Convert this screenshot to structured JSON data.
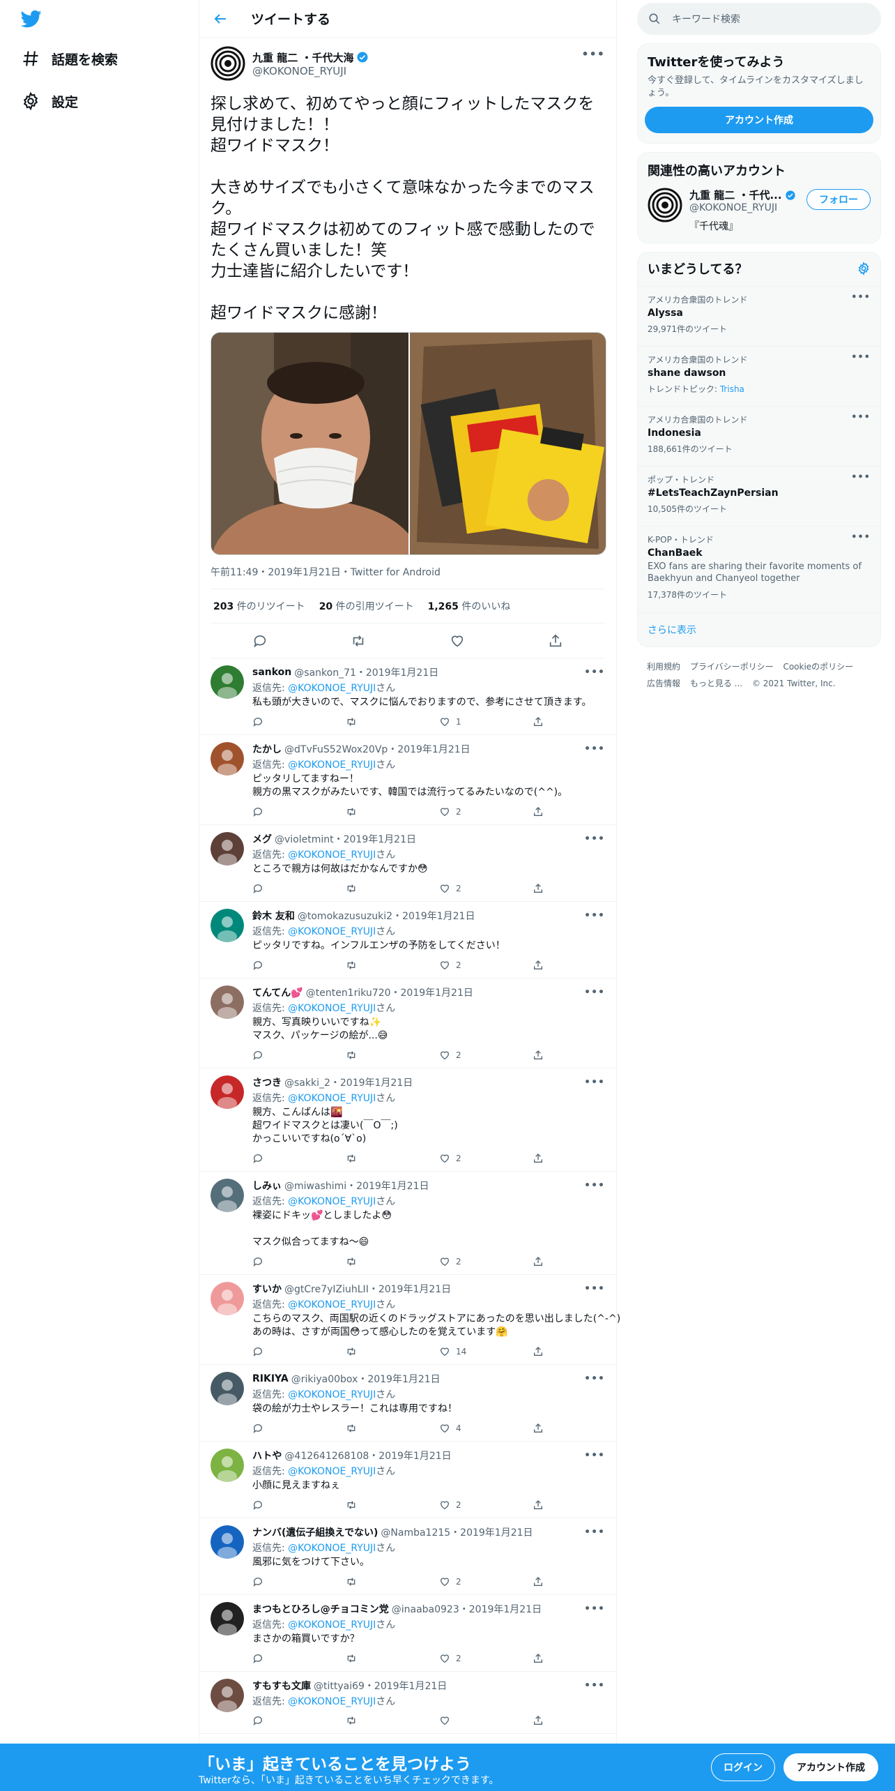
{
  "nav": {
    "logo": "twitter-logo",
    "explore": "話題を検索",
    "settings": "設定"
  },
  "header": {
    "title": "ツイートする"
  },
  "main_tweet": {
    "name": "九重 龍二 ・千代大海",
    "handle": "@KOKONOE_RYUJI",
    "text": "探し求めて、初めてやっと顔にフィットしたマスクを見付けました！！\n超ワイドマスク！\n\n大きめサイズでも小さくて意味なかった今までのマスク。\n超ワイドマスクは初めてのフィット感で感動したのでたくさん買いました！笑\n力士達皆に紹介したいです！\n\n超ワイドマスクに感謝！",
    "meta": "午前11:49・2019年1月21日・Twitter for Android",
    "retweets": "203",
    "retweets_label": "件のリツイート",
    "quotes": "20",
    "quotes_label": "件の引用ツイート",
    "likes": "1,265",
    "likes_label": "件のいいね"
  },
  "reply_prefix": "返信先: ",
  "reply_to": "@KOKONOE_RYUJI",
  "reply_suffix": "さん",
  "replies": [
    {
      "name": "sankon",
      "meta": "@sankon_71・2019年1月21日",
      "text": "私も頭が大きいので、マスクに悩んでおりますので、参考にさせて頂きます。",
      "likes": "1"
    },
    {
      "name": "たかし",
      "meta": "@dTvFuS52Wox20Vp・2019年1月21日",
      "text": "ピッタリしてますねー！\n親方の黒マスクがみたいです、韓国では流行ってるみたいなので(^^)。",
      "likes": "2"
    },
    {
      "name": "メグ",
      "meta": "@violetmint・2019年1月21日",
      "text": "ところで親方は何故はだかなんですか😳",
      "likes": "2"
    },
    {
      "name": "鈴木 友和",
      "meta": "@tomokazusuzuki2・2019年1月21日",
      "text": "ピッタリですね。インフルエンザの予防をしてください！",
      "likes": "2"
    },
    {
      "name": "てんてん💕",
      "meta": "@tenten1riku720・2019年1月21日",
      "text": "親方、写真映りいいですね✨\nマスク、パッケージの絵が...😅",
      "likes": "2"
    },
    {
      "name": "さつき",
      "meta": "@sakki_2・2019年1月21日",
      "text": "親方、こんばんは🌇\n超ワイドマスクとは凄い(￣O￣;)\nかっこいいですね(o´∀`o)",
      "likes": "2"
    },
    {
      "name": "しみぃ",
      "meta": "@miwashimi・2019年1月21日",
      "text": "裸姿にドキッ💕としましたよ😳\n\nマスク似合ってますね～😄",
      "likes": "2"
    },
    {
      "name": "すいか",
      "meta": "@gtCre7yIZiuhLII・2019年1月21日",
      "text": "こちらのマスク、両国駅の近くのドラッグストアにあったのを思い出しました(^-^)\nあの時は、さすが両国😳って感心したのを覚えています🤗",
      "likes": "14"
    },
    {
      "name": "RIKIYA",
      "meta": "@rikiya00box・2019年1月21日",
      "text": "袋の絵が力士やレスラー！これは専用ですね！",
      "likes": "4"
    },
    {
      "name": "ハトや",
      "meta": "@412641268108・2019年1月21日",
      "text": "小顔に見えますねぇ",
      "likes": "2"
    },
    {
      "name": "ナンバ(遺伝子組換えでない)",
      "meta": "@Namba1215・2019年1月21日",
      "text": "風邪に気をつけて下さい。",
      "likes": "2"
    },
    {
      "name": "まつもとひろし@チョコミン党",
      "meta": "@inaaba0923・2019年1月21日",
      "text": "まさかの箱買いですか？",
      "likes": "2"
    },
    {
      "name": "すもすも文庫",
      "meta": "@tittyai69・2019年1月21日",
      "text": "",
      "likes": ""
    }
  ],
  "right": {
    "search_placeholder": "キーワード検索",
    "join_title": "Twitterを使ってみよう",
    "join_sub": "今すぐ登録して、タイムラインをカスタマイズしましょう。",
    "join_button": "アカウント作成",
    "related_title": "関連性の高いアカウント",
    "related_name": "九重 龍二 ・千代...",
    "related_handle": "@KOKONOE_RYUJI",
    "related_bio": "『千代魂』",
    "follow": "フォロー",
    "trends_title": "いまどうしてる？",
    "trends": [
      {
        "context": "アメリカ合衆国のトレンド",
        "name": "Alyssa",
        "count": "29,971件のツイート"
      },
      {
        "context": "アメリカ合衆国のトレンド",
        "name": "shane dawson",
        "count": "トレンドトピック: ",
        "topic": "Trisha"
      },
      {
        "context": "アメリカ合衆国のトレンド",
        "name": "Indonesia",
        "count": "188,661件のツイート"
      },
      {
        "context": "ポップ・トレンド",
        "name": "#LetsTeachZaynPersian",
        "count": "10,505件のツイート"
      },
      {
        "context": "K-POP・トレンド",
        "name": "ChanBaek",
        "desc": "EXO fans are sharing their favorite moments of Baekhyun and Chanyeol together",
        "count": "17,378件のツイート"
      }
    ],
    "show_more": "さらに表示",
    "footer": [
      "利用規約",
      "プライバシーポリシー",
      "Cookieのポリシー",
      "広告情報",
      "もっと見る ...",
      "© 2021 Twitter, Inc."
    ]
  },
  "bottom": {
    "title": "「いま」起きていることを見つけよう",
    "sub": "Twitterなら、「いま」起きていることをいち早くチェックできます。",
    "login": "ログイン",
    "signup": "アカウント作成"
  },
  "colors": {
    "accent": "#1d9bf0",
    "text": "#0f1419",
    "muted": "#536471"
  }
}
